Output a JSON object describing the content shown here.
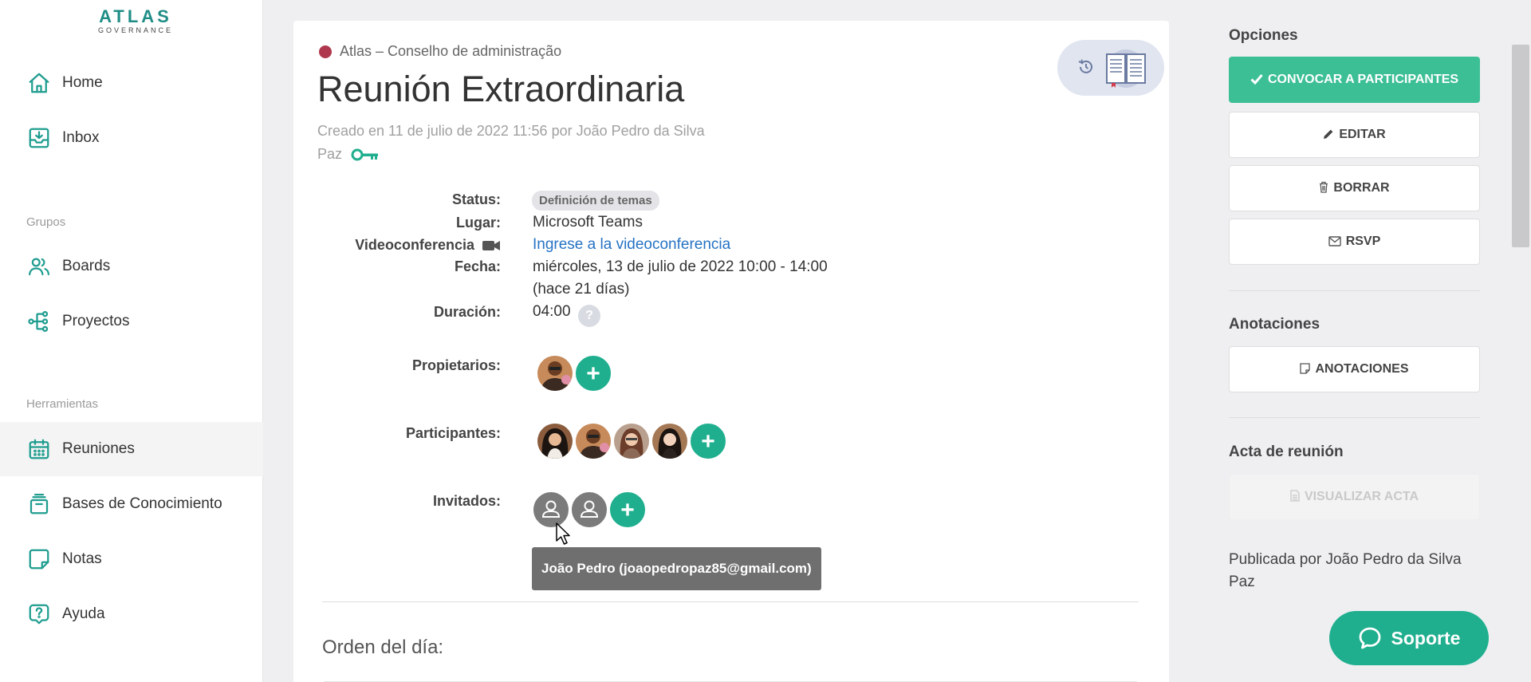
{
  "logo": {
    "main": "ATLAS",
    "sub": "GOVERNANCE"
  },
  "sidebar": {
    "items_top": [
      {
        "label": "Home",
        "icon": "home-icon"
      },
      {
        "label": "Inbox",
        "icon": "inbox-icon"
      }
    ],
    "section_groups": "Grupos",
    "items_groups": [
      {
        "label": "Boards",
        "icon": "users-icon"
      },
      {
        "label": "Proyectos",
        "icon": "project-tree-icon"
      }
    ],
    "section_tools": "Herramientas",
    "items_tools": [
      {
        "label": "Reuniones",
        "icon": "calendar-icon",
        "active": true
      },
      {
        "label": "Bases de Conocimiento",
        "icon": "archive-icon"
      },
      {
        "label": "Notas",
        "icon": "note-icon"
      },
      {
        "label": "Ayuda",
        "icon": "help-icon"
      }
    ]
  },
  "meeting": {
    "organization": "Atlas – Conselho de administração",
    "title": "Reunión Extraordinaria",
    "created": "Creado en 11 de julio de 2022 11:56 por João Pedro da Silva Paz",
    "fields": {
      "status_label": "Status:",
      "status_value": "Definición de temas",
      "lugar_label": "Lugar:",
      "lugar_value": "Microsoft Teams",
      "video_label": "Videoconferencia",
      "video_link": "Ingrese a la videoconferencia",
      "fecha_label": "Fecha:",
      "fecha_value": "miércoles, 13 de julio de 2022 10:00 - 14:00",
      "fecha_relative": "(hace 21 días)",
      "duracion_label": "Duración:",
      "duracion_value": "04:00",
      "duracion_help": "?",
      "propietarios_label": "Propietarios:",
      "participantes_label": "Participantes:",
      "invitados_label": "Invitados:"
    },
    "plus_symbol": "+",
    "tooltip": "João Pedro (joaopedropaz85@gmail.com)",
    "orden_del_dia": "Orden del día:"
  },
  "right_panel": {
    "opciones_title": "Opciones",
    "convocar": "Convocar a participantes",
    "editar": "Editar",
    "borrar": "Borrar",
    "rsvp": "RSVP",
    "anotaciones_title": "Anotaciones",
    "anotaciones_button": "Anotaciones",
    "acta_title": "Acta de reunión",
    "visualizar_acta": "Visualizar acta",
    "published_by": "Publicada por João Pedro da Silva Paz"
  },
  "support_button": "Soporte",
  "colors": {
    "accent": "#1faf8e",
    "primary_button": "#3dbf95",
    "org_dot": "#b0384e",
    "link": "#2673c4"
  }
}
